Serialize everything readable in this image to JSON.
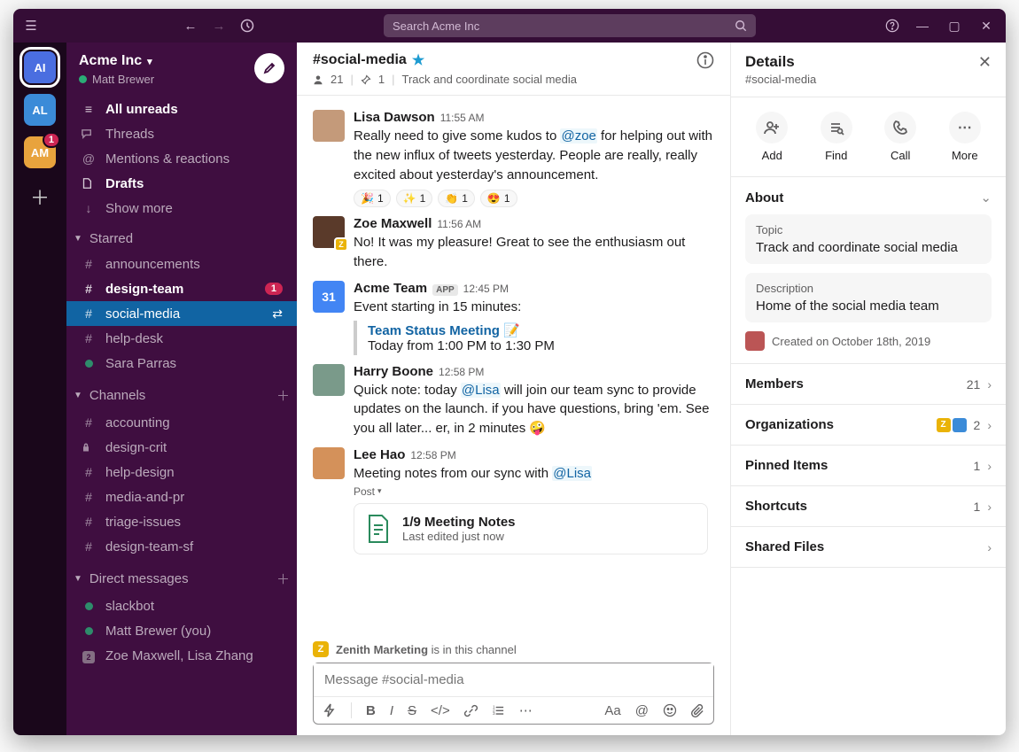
{
  "titlebar": {
    "search_placeholder": "Search Acme Inc"
  },
  "workspaces": [
    {
      "abbr": "AI",
      "badge": null,
      "active": true
    },
    {
      "abbr": "AL",
      "badge": null,
      "active": false
    },
    {
      "abbr": "AM",
      "badge": "1",
      "active": false
    }
  ],
  "sidebar": {
    "workspace_name": "Acme Inc",
    "user_name": "Matt Brewer",
    "top": [
      {
        "icon": "≡",
        "label": "All unreads",
        "bold": true
      },
      {
        "icon": "chat",
        "label": "Threads"
      },
      {
        "icon": "@",
        "label": "Mentions & reactions"
      },
      {
        "icon": "file",
        "label": "Drafts",
        "bold": true
      },
      {
        "icon": "↓",
        "label": "Show more"
      }
    ],
    "starred_heading": "Starred",
    "starred": [
      {
        "prefix": "#",
        "label": "announcements"
      },
      {
        "prefix": "#",
        "label": "design-team",
        "bold": true,
        "badge": "1"
      },
      {
        "prefix": "#",
        "label": "social-media",
        "active": true,
        "swap": true
      },
      {
        "prefix": "#",
        "label": "help-desk"
      },
      {
        "prefix": "presence",
        "label": "Sara Parras"
      }
    ],
    "channels_heading": "Channels",
    "channels": [
      {
        "prefix": "#",
        "label": "accounting"
      },
      {
        "prefix": "lock",
        "label": "design-crit"
      },
      {
        "prefix": "#",
        "label": "help-design"
      },
      {
        "prefix": "#",
        "label": "media-and-pr"
      },
      {
        "prefix": "#",
        "label": "triage-issues"
      },
      {
        "prefix": "#",
        "label": "design-team-sf"
      }
    ],
    "dm_heading": "Direct messages",
    "dms": [
      {
        "prefix": "presence",
        "label": "slackbot"
      },
      {
        "prefix": "presence",
        "label": "Matt Brewer (you)"
      },
      {
        "prefix": "square",
        "label": "Zoe Maxwell, Lisa Zhang"
      }
    ]
  },
  "channel": {
    "name": "#social-media",
    "members": "21",
    "pins": "1",
    "topic": "Track and coordinate social media"
  },
  "messages": [
    {
      "author": "Lisa Dawson",
      "time": "11:55 AM",
      "avatar_bg": "#c49a7a",
      "text_pre": "Really need to give some kudos to ",
      "mention": "@zoe",
      "text_post": " for helping out with the new influx of tweets yesterday. People are really, really excited about yesterday's announcement.",
      "reacts": [
        {
          "e": "🎉",
          "c": "1"
        },
        {
          "e": "✨",
          "c": "1"
        },
        {
          "e": "👏",
          "c": "1"
        },
        {
          "e": "😍",
          "c": "1"
        }
      ]
    },
    {
      "author": "Zoe Maxwell",
      "time": "11:56 AM",
      "avatar_bg": "#5a3a2a",
      "sub_badge": "Z",
      "text": "No! It was my pleasure! Great to see the enthusiasm out there."
    },
    {
      "author": "Acme Team",
      "time": "12:45 PM",
      "app": "APP",
      "avatar_bg": "#4285f4",
      "avatar_text": "31",
      "text": "Event starting in 15 minutes:",
      "callout_title": "Team Status Meeting 📝",
      "callout_sub": "Today from 1:00 PM to 1:30 PM"
    },
    {
      "author": "Harry Boone",
      "time": "12:58 PM",
      "avatar_bg": "#7a9a8a",
      "text_pre": "Quick note: today ",
      "mention": "@Lisa",
      "text_post": " will join our team sync to provide updates on the launch. if you have questions, bring 'em. See you all later... er, in 2 minutes 🤪"
    },
    {
      "author": "Lee Hao",
      "time": "12:58 PM",
      "avatar_bg": "#d4915a",
      "text_pre": "Meeting notes from our sync with ",
      "mention": "@Lisa",
      "post_label": "Post",
      "attach_title": "1/9 Meeting Notes",
      "attach_sub": "Last edited just now"
    }
  ],
  "channel_note": {
    "org": "Z",
    "name": "Zenith Marketing",
    "suffix": " is in this channel"
  },
  "composer": {
    "placeholder": "Message #social-media"
  },
  "details": {
    "title": "Details",
    "subtitle": "#social-media",
    "actions": [
      {
        "label": "Add",
        "name": "add-person"
      },
      {
        "label": "Find",
        "name": "find"
      },
      {
        "label": "Call",
        "name": "call"
      },
      {
        "label": "More",
        "name": "more"
      }
    ],
    "about_heading": "About",
    "topic_label": "Topic",
    "topic_value": "Track and coordinate social media",
    "desc_label": "Description",
    "desc_value": "Home of the social media team",
    "created": "Created on October 18th, 2019",
    "sections": [
      {
        "label": "Members",
        "count": "21"
      },
      {
        "label": "Organizations",
        "count": "2",
        "orgs": true
      },
      {
        "label": "Pinned Items",
        "count": "1"
      },
      {
        "label": "Shortcuts",
        "count": "1"
      },
      {
        "label": "Shared Files",
        "count": ""
      }
    ]
  }
}
